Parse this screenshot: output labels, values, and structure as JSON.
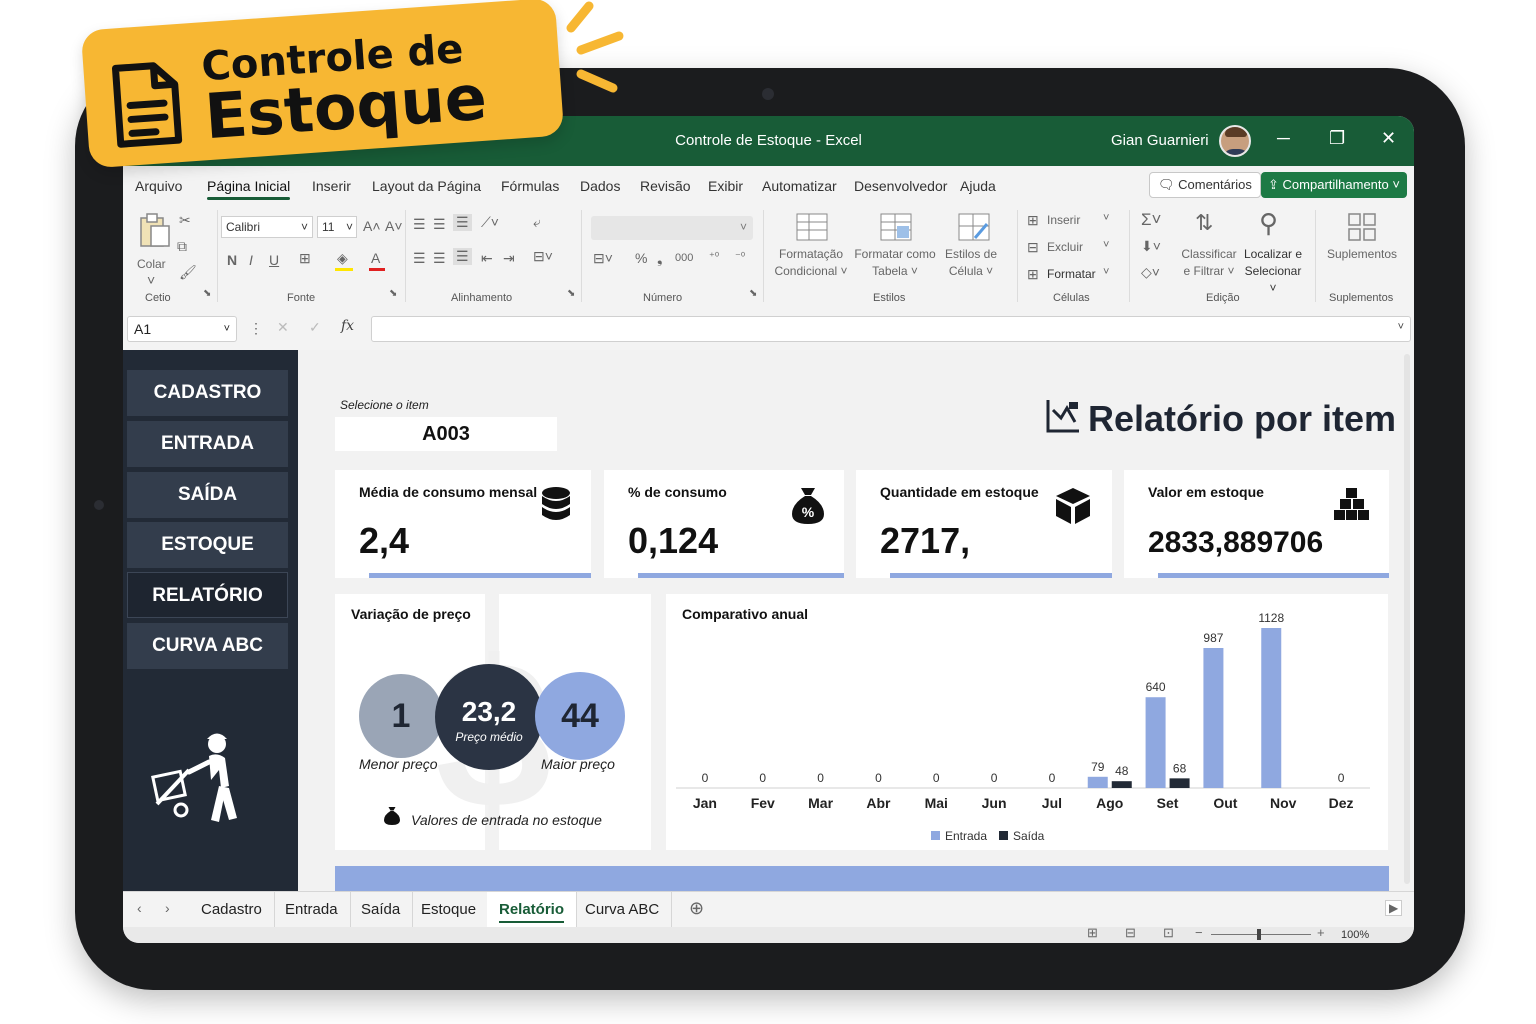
{
  "badge": {
    "line1": "Controle de",
    "line2": "Estoque"
  },
  "window": {
    "title": "Controle de Estoque - Excel",
    "user": "Gian Guarnieri",
    "minimize": "─",
    "restore": "❐",
    "close": "✕"
  },
  "menu": {
    "tabs": [
      "Arquivo",
      "Página Inicial",
      "Inserir",
      "Layout da Página",
      "Fórmulas",
      "Dados",
      "Revisão",
      "Exibir",
      "Automatizar",
      "Desenvolvedor",
      "Ajuda"
    ],
    "comments": "Comentários",
    "share": "Compartilhamento"
  },
  "ribbon": {
    "paste": "Colar",
    "font_name": "Calibri",
    "font_size": "11",
    "groups": {
      "clipboard": "Cetio",
      "font": "Fonte",
      "alignment": "Alinhamento",
      "number": "Número",
      "styles": "Estilos",
      "cells": "Células",
      "editing": "Edição",
      "addins": "Suplementos"
    },
    "cond_format": "Formatação\nCondicional ˅",
    "format_table": "Formatar como\nTabela ˅",
    "cell_styles": "Estilos de\nCélula ˅",
    "insert": "Inserir",
    "delete": "Excluir",
    "format": "Formatar",
    "sort_filter": "Classificar\ne Filtrar ˅",
    "find_select": "Localizar e\nSelecionar ˅",
    "addins": "Suplementos",
    "bold": "N",
    "italic": "I",
    "underline": "U"
  },
  "formula": {
    "name_box": "A1",
    "fx": "fx",
    "value": ""
  },
  "sidebar": {
    "items": [
      "CADASTRO",
      "ENTRADA",
      "SAÍDA",
      "ESTOQUE",
      "RELATÓRIO",
      "CURVA ABC"
    ],
    "active": "RELATÓRIO"
  },
  "report": {
    "select_label": "Selecione o item",
    "selected_item": "A003",
    "title": "Relatório por item",
    "cards": [
      {
        "title": "Média de consumo mensal",
        "value": "2,4",
        "icon": "database-icon"
      },
      {
        "title": "% de consumo",
        "value": "0,124",
        "icon": "money-bag-percent-icon"
      },
      {
        "title": "Quantidade em estoque",
        "value": "2717,",
        "icon": "box-icon"
      },
      {
        "title": "Valor em estoque",
        "value": "2833,889706",
        "icon": "stacked-boxes-icon"
      }
    ],
    "price": {
      "title": "Variação de preço",
      "min_value": "1",
      "min_label": "Menor preço",
      "avg_value": "23,2",
      "avg_label": "Preço médio",
      "max_value": "44",
      "max_label": "Maior preço",
      "note": "Valores de entrada no estoque"
    },
    "chart_title": "Comparativo anual"
  },
  "chart_data": {
    "type": "bar",
    "title": "Comparativo anual",
    "categories": [
      "Jan",
      "Fev",
      "Mar",
      "Abr",
      "Mai",
      "Jun",
      "Jul",
      "Ago",
      "Set",
      "Out",
      "Nov",
      "Dez"
    ],
    "series": [
      {
        "name": "Entrada",
        "values": [
          0,
          0,
          0,
          0,
          0,
          0,
          0,
          79,
          640,
          987,
          1128,
          0
        ],
        "color": "#8fa8e0"
      },
      {
        "name": "Saída",
        "values": [
          0,
          0,
          0,
          0,
          0,
          0,
          0,
          48,
          68,
          0,
          0,
          0
        ],
        "color": "#222a36"
      }
    ],
    "legend": "bottom",
    "grid": false,
    "ylim": [
      0,
      1128
    ]
  },
  "sheet_tabs": {
    "items": [
      "Cadastro",
      "Entrada",
      "Saída",
      "Estoque",
      "Relatório",
      "Curva ABC"
    ],
    "active": "Relatório"
  },
  "status": {
    "zoom": "100%"
  },
  "colors": {
    "excel_green": "#185c37",
    "navy": "#222a36",
    "accent_blue": "#8fa8e0",
    "badge_yellow": "#f7b733"
  }
}
